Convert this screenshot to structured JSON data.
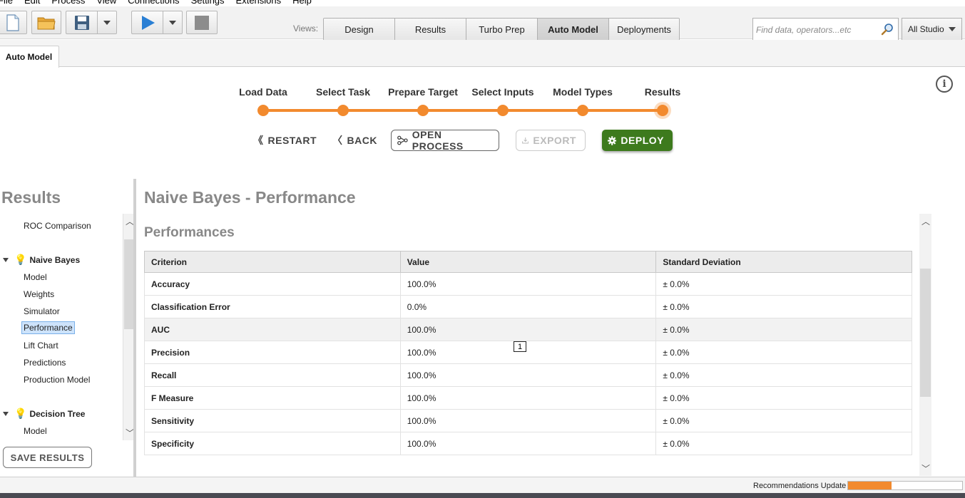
{
  "menu": [
    "File",
    "Edit",
    "Process",
    "View",
    "Connections",
    "Settings",
    "Extensions",
    "Help"
  ],
  "toolbar": {
    "views_label": "Views:",
    "views": [
      {
        "label": "Design",
        "active": false
      },
      {
        "label": "Results",
        "active": false
      },
      {
        "label": "Turbo Prep",
        "active": false
      },
      {
        "label": "Auto Model",
        "active": true
      },
      {
        "label": "Deployments",
        "active": false
      }
    ],
    "search_placeholder": "Find data, operators...etc",
    "studio_label": "All Studio"
  },
  "tab": {
    "label": "Auto Model"
  },
  "wizard": {
    "steps": [
      "Load Data",
      "Select Task",
      "Prepare Target",
      "Select Inputs",
      "Model Types",
      "Results"
    ],
    "current_step": "Results",
    "buttons": {
      "restart": "RESTART",
      "back": "BACK",
      "open_process": "OPEN PROCESS",
      "export": "EXPORT",
      "deploy": "DEPLOY"
    }
  },
  "left_panel": {
    "title": "Results",
    "items": [
      {
        "label": "ROC Comparison",
        "type": "sub"
      },
      {
        "label": "Naive Bayes",
        "type": "group"
      },
      {
        "label": "Model",
        "type": "sub"
      },
      {
        "label": "Weights",
        "type": "sub"
      },
      {
        "label": "Simulator",
        "type": "sub"
      },
      {
        "label": "Performance",
        "type": "sub",
        "selected": true
      },
      {
        "label": "Lift Chart",
        "type": "sub"
      },
      {
        "label": "Predictions",
        "type": "sub"
      },
      {
        "label": "Production Model",
        "type": "sub"
      },
      {
        "label": "Decision Tree",
        "type": "group"
      },
      {
        "label": "Model",
        "type": "sub"
      }
    ],
    "save_button": "SAVE RESULTS"
  },
  "main": {
    "title": "Naive Bayes - Performance",
    "section": "Performances",
    "table": {
      "headers": [
        "Criterion",
        "Value",
        "Standard Deviation"
      ],
      "rows": [
        [
          "Accuracy",
          "100.0%",
          "± 0.0%"
        ],
        [
          "Classification Error",
          "0.0%",
          "± 0.0%"
        ],
        [
          "AUC",
          "100.0%",
          "± 0.0%"
        ],
        [
          "Precision",
          "100.0%",
          "± 0.0%"
        ],
        [
          "Recall",
          "100.0%",
          "± 0.0%"
        ],
        [
          "F Measure",
          "100.0%",
          "± 0.0%"
        ],
        [
          "Sensitivity",
          "100.0%",
          "± 0.0%"
        ],
        [
          "Specificity",
          "100.0%",
          "± 0.0%"
        ]
      ],
      "highlighted_row": 2
    },
    "marker": "1"
  },
  "status": {
    "text": "Recommendations Update",
    "progress": 0.38
  },
  "colors": {
    "accent": "#f28a2e",
    "deploy": "#3d7a1d",
    "selection": "#cde3fb"
  }
}
